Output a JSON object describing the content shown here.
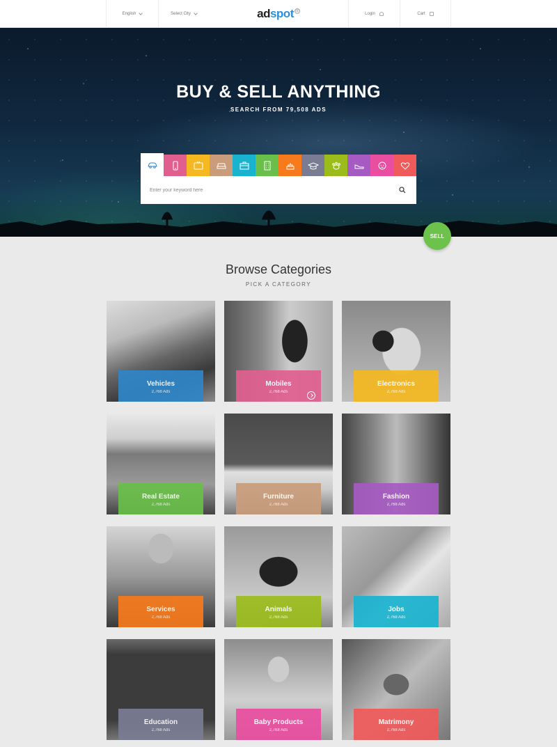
{
  "header": {
    "language": "English",
    "city": "Select City",
    "logo_ad": "ad",
    "logo_spot": "spot",
    "logo_reg": "®",
    "login": "Login",
    "cart": "Cart"
  },
  "hero": {
    "title": "BUY & SELL ANYTHING",
    "subtitle": "SEARCH FROM 79,508 ADS",
    "search_placeholder": "Enter your keyword here",
    "sell_label": "SELL",
    "tabs": [
      {
        "icon": "car-icon",
        "color": "#ffffff"
      },
      {
        "icon": "mobile-icon",
        "color": "#e05f8f"
      },
      {
        "icon": "tv-icon",
        "color": "#f5b820"
      },
      {
        "icon": "sofa-icon",
        "color": "#c99d7b"
      },
      {
        "icon": "briefcase-icon",
        "color": "#1ab3cf"
      },
      {
        "icon": "building-icon",
        "color": "#6abf4a"
      },
      {
        "icon": "cake-icon",
        "color": "#f77a1c"
      },
      {
        "icon": "graduation-cap-icon",
        "color": "#7a7c93"
      },
      {
        "icon": "paw-icon",
        "color": "#9cbc1c"
      },
      {
        "icon": "shoe-icon",
        "color": "#a65bc2"
      },
      {
        "icon": "baby-icon",
        "color": "#ea4ea0"
      },
      {
        "icon": "heart-icon",
        "color": "#f05a5a"
      }
    ]
  },
  "browse": {
    "title": "Browse Categories",
    "subtitle": "PICK A CATEGORY"
  },
  "categories": [
    {
      "name": "Vehicles",
      "count": "2,768 Ads",
      "color": "#2f86c9"
    },
    {
      "name": "Mobiles",
      "count": "2,768 Ads",
      "color": "#e05f8f"
    },
    {
      "name": "Electronics",
      "count": "2,768 Ads",
      "color": "#f5b820"
    },
    {
      "name": "Real Estate",
      "count": "2,768 Ads",
      "color": "#6abf4a"
    },
    {
      "name": "Furniture",
      "count": "2,768 Ads",
      "color": "#c99d7b"
    },
    {
      "name": "Fashion",
      "count": "2,768 Ads",
      "color": "#a65bc2"
    },
    {
      "name": "Services",
      "count": "2,768 Ads",
      "color": "#f77a1c"
    },
    {
      "name": "Animals",
      "count": "2,768 Ads",
      "color": "#9cbc1c"
    },
    {
      "name": "Jobs",
      "count": "2,768 Ads",
      "color": "#1ab3cf"
    },
    {
      "name": "Education",
      "count": "2,768 Ads",
      "color": "#7a7c93"
    },
    {
      "name": "Baby Products",
      "count": "2,768 Ads",
      "color": "#ea4ea0"
    },
    {
      "name": "Matrimony",
      "count": "2,768 Ads",
      "color": "#f05a5a"
    }
  ]
}
